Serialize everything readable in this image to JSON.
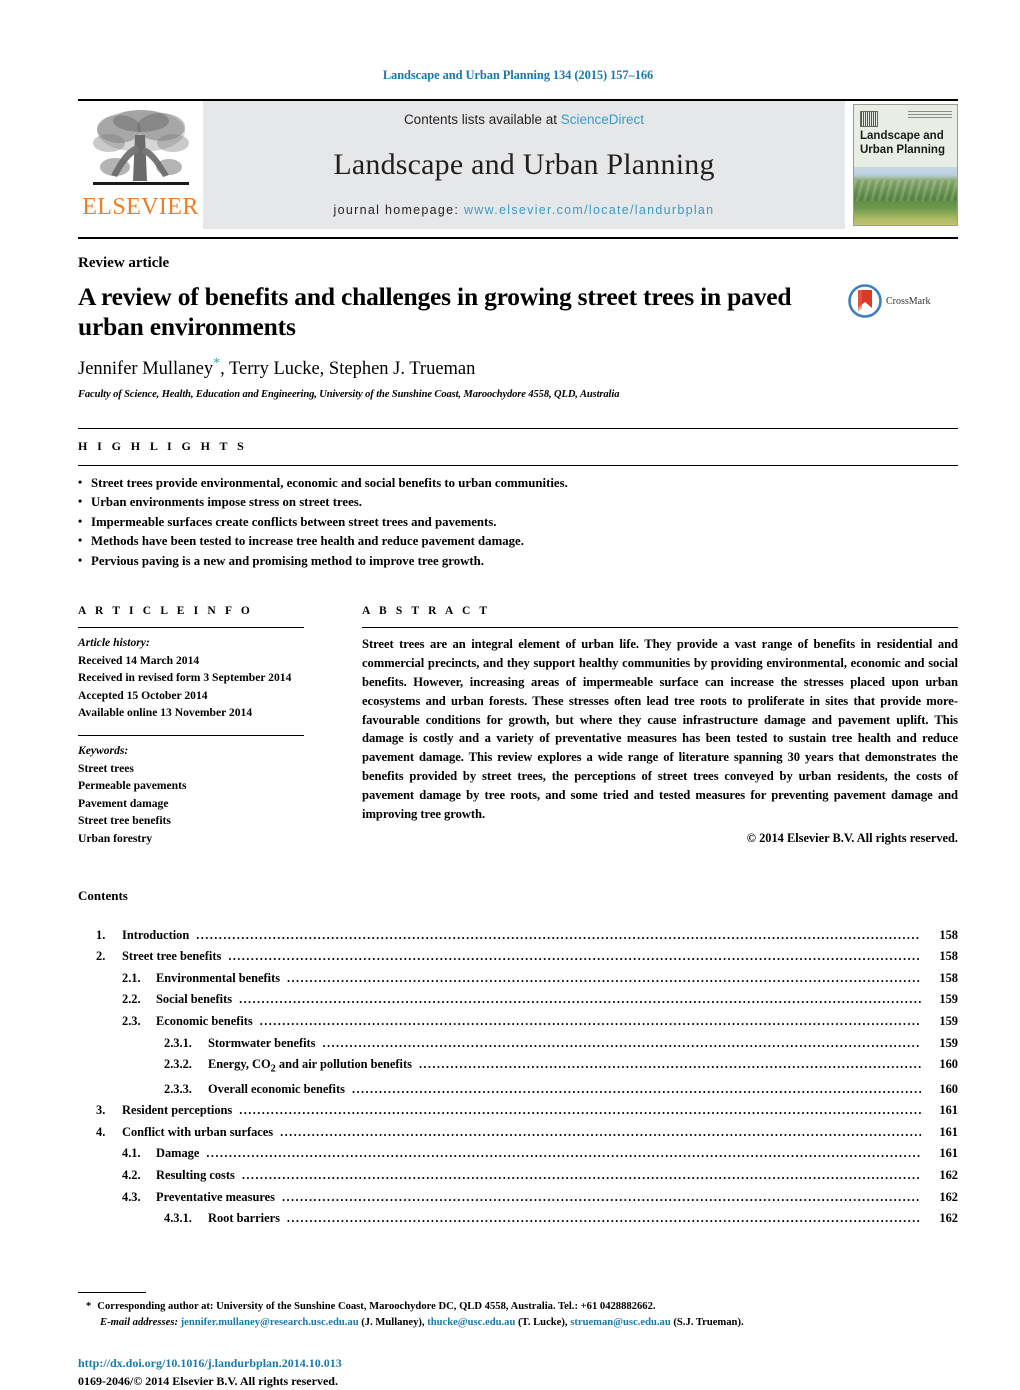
{
  "running_head": "Landscape and Urban Planning 134 (2015) 157–166",
  "masthead": {
    "elsevier_wordmark": "ELSEVIER",
    "contents_prefix": "Contents lists available at ",
    "sciencedirect": "ScienceDirect",
    "journal_name": "Landscape and Urban Planning",
    "homepage_prefix": "journal homepage: ",
    "homepage_url": "www.elsevier.com/locate/landurbplan",
    "cover_title_line1": "Landscape and",
    "cover_title_line2": "Urban Planning",
    "link_color": "#3a9cc4"
  },
  "article": {
    "type": "Review article",
    "title": "A review of benefits and challenges in growing street trees in paved urban environments",
    "authors": "Jennifer Mullaney",
    "corresponding_marker": "*",
    "authors_rest": ", Terry Lucke, Stephen J. Trueman",
    "affiliation": "Faculty of Science, Health, Education and Engineering, University of the Sunshine Coast, Maroochydore 4558, QLD, Australia",
    "crossmark_label": "CrossMark"
  },
  "highlights": {
    "heading": "HIGHLIGHTS",
    "items": [
      "Street trees provide environmental, economic and social benefits to urban communities.",
      "Urban environments impose stress on street trees.",
      "Impermeable surfaces create conflicts between street trees and pavements.",
      "Methods have been tested to increase tree health and reduce pavement damage.",
      "Pervious paving is a new and promising method to improve tree growth."
    ]
  },
  "article_info": {
    "heading": "ARTICLE INFO",
    "history_label": "Article history:",
    "history": [
      "Received 14 March 2014",
      "Received in revised form 3 September 2014",
      "Accepted 15 October 2014",
      "Available online 13 November 2014"
    ],
    "keywords_label": "Keywords:",
    "keywords": [
      "Street trees",
      "Permeable pavements",
      "Pavement damage",
      "Street tree benefits",
      "Urban forestry"
    ]
  },
  "abstract": {
    "heading": "ABSTRACT",
    "text": "Street trees are an integral element of urban life. They provide a vast range of benefits in residential and commercial precincts, and they support healthy communities by providing environmental, economic and social benefits. However, increasing areas of impermeable surface can increase the stresses placed upon urban ecosystems and urban forests. These stresses often lead tree roots to proliferate in sites that provide more-favourable conditions for growth, but where they cause infrastructure damage and pavement uplift. This damage is costly and a variety of preventative measures has been tested to sustain tree health and reduce pavement damage. This review explores a wide range of literature spanning 30 years that demonstrates the benefits provided by street trees, the perceptions of street trees conveyed by urban residents, the costs of pavement damage by tree roots, and some tried and tested measures for preventing pavement damage and improving tree growth.",
    "copyright": "© 2014 Elsevier B.V. All rights reserved."
  },
  "contents": {
    "heading": "Contents",
    "entries": [
      {
        "level": 1,
        "number": "1.",
        "label": "Introduction",
        "page": "158"
      },
      {
        "level": 1,
        "number": "2.",
        "label": "Street tree benefits",
        "page": "158"
      },
      {
        "level": 2,
        "number": "2.1.",
        "label": "Environmental benefits",
        "page": "158"
      },
      {
        "level": 2,
        "number": "2.2.",
        "label": "Social benefits",
        "page": "159"
      },
      {
        "level": 2,
        "number": "2.3.",
        "label": "Economic benefits",
        "page": "159"
      },
      {
        "level": 3,
        "number": "2.3.1.",
        "label": "Stormwater benefits",
        "page": "159"
      },
      {
        "level": 3,
        "number": "2.3.2.",
        "label": "Energy, CO2 and air pollution benefits",
        "page": "160"
      },
      {
        "level": 3,
        "number": "2.3.3.",
        "label": "Overall economic benefits",
        "page": "160"
      },
      {
        "level": 1,
        "number": "3.",
        "label": "Resident perceptions",
        "page": "161"
      },
      {
        "level": 1,
        "number": "4.",
        "label": "Conflict with urban surfaces",
        "page": "161"
      },
      {
        "level": 2,
        "number": "4.1.",
        "label": "Damage",
        "page": "161"
      },
      {
        "level": 2,
        "number": "4.2.",
        "label": "Resulting costs",
        "page": "162"
      },
      {
        "level": 2,
        "number": "4.3.",
        "label": "Preventative measures",
        "page": "162"
      },
      {
        "level": 3,
        "number": "4.3.1.",
        "label": "Root barriers",
        "page": "162"
      }
    ]
  },
  "footnotes": {
    "corresponding_marker": "*",
    "corresponding_text": "Corresponding author at: University of the Sunshine Coast, Maroochydore DC, QLD 4558, Australia. Tel.: +61 0428882662.",
    "email_label": "E-mail addresses:",
    "emails": [
      {
        "address": "jennifer.mullaney@research.usc.edu.au",
        "person": "(J. Mullaney),"
      },
      {
        "address": "thucke@usc.edu.au",
        "person": "(T. Lucke),"
      },
      {
        "address": "strueman@usc.edu.au",
        "person": "(S.J. Trueman)."
      }
    ]
  },
  "doi": {
    "url": "http://dx.doi.org/10.1016/j.landurbplan.2014.10.013",
    "issn_line": "0169-2046/© 2014 Elsevier B.V. All rights reserved."
  }
}
